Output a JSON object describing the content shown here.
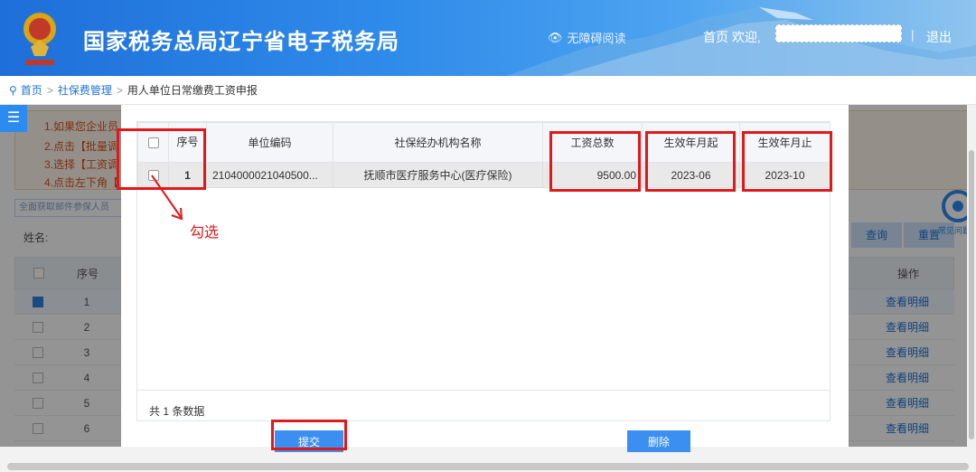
{
  "header": {
    "site_title": "国家税务总局辽宁省电子税务局",
    "accessibility_label": "无障碍阅读",
    "home_label": "首页",
    "welcome_label": "欢迎,",
    "logout_label": "退出",
    "separator": "|"
  },
  "breadcrumb": {
    "home": "首页",
    "section": "社保费管理",
    "current": "用人单位日常缴费工资申报",
    "sep": ">"
  },
  "background_page": {
    "notices": [
      "1.如果您企业员",
      "2.点击【批量调",
      "3.选择【工资调",
      "4.点击左下角【"
    ],
    "filter_label": "全面获取邮件参保人员",
    "name_label": "姓名:",
    "buttons": [
      "查询",
      "重置"
    ],
    "table": {
      "headers": [
        "序号",
        "操作"
      ],
      "rows": [
        {
          "no": "1",
          "action": "查看明细",
          "checked": true
        },
        {
          "no": "2",
          "action": "查看明细",
          "checked": false
        },
        {
          "no": "3",
          "action": "查看明细",
          "checked": false
        },
        {
          "no": "4",
          "action": "查看明细",
          "checked": false
        },
        {
          "no": "5",
          "action": "查看明细",
          "checked": false
        },
        {
          "no": "6",
          "action": "查看明细",
          "checked": false
        }
      ]
    },
    "help_label": "常见问题"
  },
  "modal": {
    "columns": [
      "序号",
      "单位编码",
      "社保经办机构名称",
      "工资总数",
      "生效年月起",
      "生效年月止"
    ],
    "rows": [
      {
        "no": "1",
        "unit_code": "2104000021040500...",
        "agency": "抚顺市医疗服务中心(医疗保险)",
        "total_salary": "9500.00",
        "start": "2023-06",
        "end": "2023-10"
      }
    ],
    "record_count": "共 1 条数据",
    "submit_label": "提交",
    "delete_label": "删除"
  },
  "annotation": {
    "text": "勾选",
    "color": "#e0191b"
  },
  "colors": {
    "brand_blue": "#1e6fd9",
    "button_blue": "#3b8ff0",
    "highlight_red": "#e0191b"
  }
}
